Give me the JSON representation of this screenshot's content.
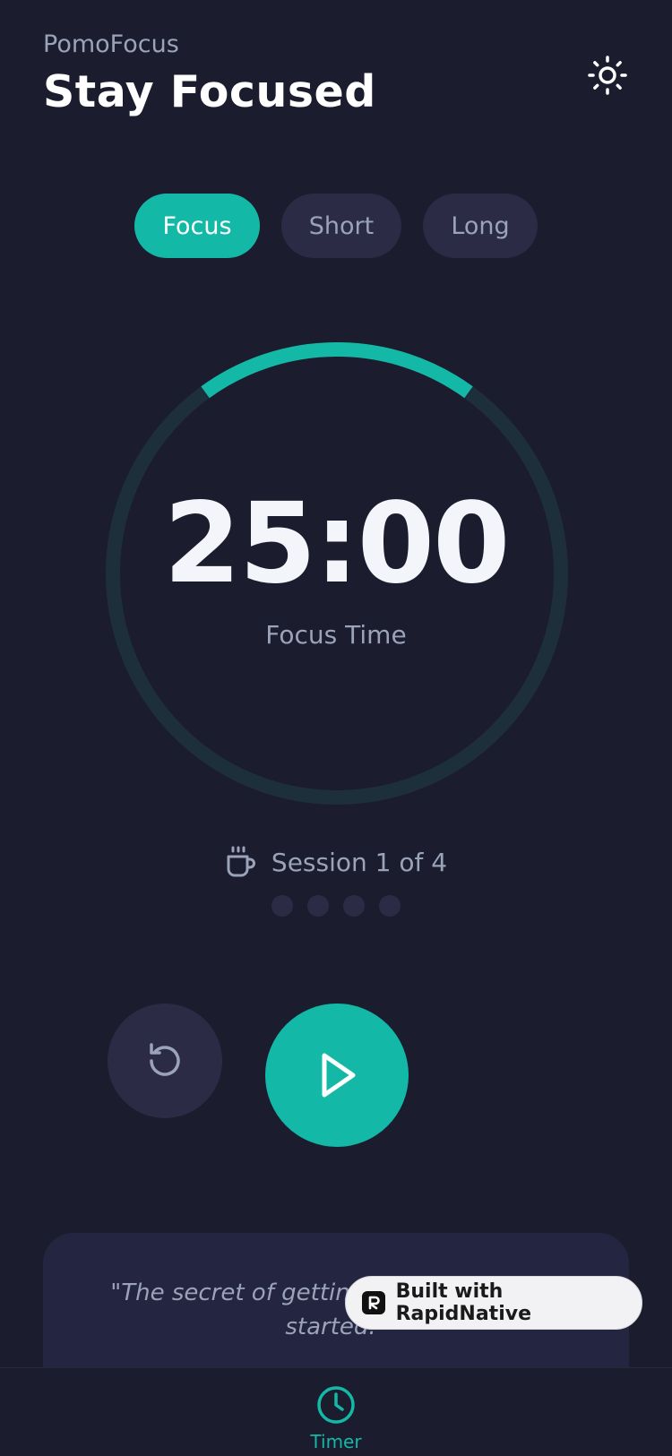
{
  "header": {
    "app_name": "PomoFocus",
    "title": "Stay Focused"
  },
  "icons": {
    "theme": "sun-icon",
    "session": "coffee-cup-icon",
    "reset": "reset-icon",
    "play": "play-icon",
    "tab_timer": "clock-icon"
  },
  "modes": [
    {
      "label": "Focus",
      "active": true
    },
    {
      "label": "Short",
      "active": false
    },
    {
      "label": "Long",
      "active": false
    }
  ],
  "timer": {
    "time": "25:00",
    "label": "Focus Time",
    "progress": 0.2
  },
  "session": {
    "text": "Session 1 of 4",
    "completed": 0,
    "total": 4
  },
  "quote": {
    "text": "\"The secret of getting ahead is getting started.\""
  },
  "badge": {
    "label": "Built with RapidNative"
  },
  "tabbar": {
    "timer_label": "Timer"
  },
  "colors": {
    "background": "#1b1c2e",
    "accent": "#14b8a6",
    "track": "#1e2f3c",
    "pill": "#2b2b46",
    "muted_text": "#9aa3b8"
  }
}
